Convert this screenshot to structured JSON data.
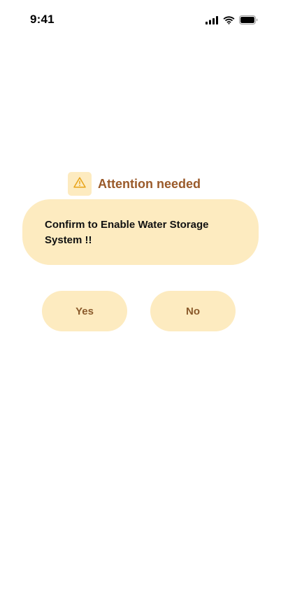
{
  "status_bar": {
    "time": "9:41",
    "icons": [
      "cellular-signal-icon",
      "wifi-icon",
      "battery-icon"
    ]
  },
  "alert": {
    "icon": "warning-triangle-icon",
    "title": "Attention needed",
    "message": "Confirm to Enable Water Storage System !!"
  },
  "actions": {
    "yes_label": "Yes",
    "no_label": "No"
  },
  "colors": {
    "accent_background": "#fdebc0",
    "title_text": "#9a5a2a",
    "button_text": "#8a5a2b",
    "warning_icon": "#e8a317"
  }
}
